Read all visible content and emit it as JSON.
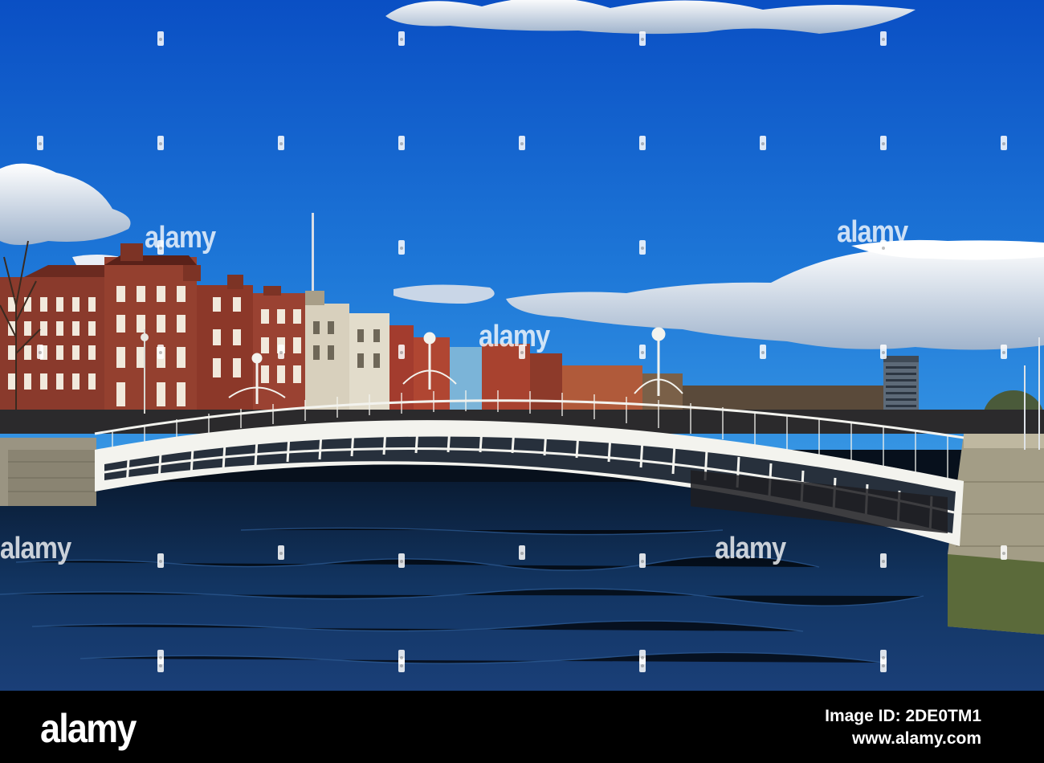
{
  "watermark": {
    "text": "alamy",
    "mark": "a"
  },
  "footer": {
    "brand": "alamy",
    "image_id_line": "Image ID: 2DE0TM1",
    "site": "www.alamy.com"
  },
  "colors": {
    "sky_top": "#0a55c8",
    "sky_bottom": "#2f8ee0",
    "river": "#0e2a52",
    "bridge": "#f4f4ef",
    "brick": "#8f3a2b",
    "footer_bg": "#000000"
  }
}
